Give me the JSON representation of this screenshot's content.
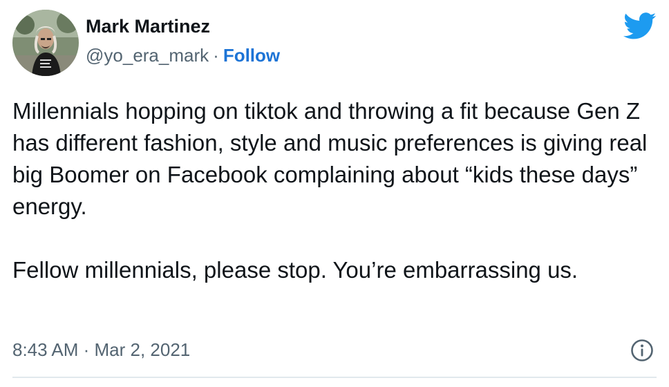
{
  "author": {
    "name": "Mark Martinez",
    "handle": "@yo_era_mark",
    "separator": "·",
    "follow_label": "Follow"
  },
  "tweet": {
    "paragraphs": [
      "Millennials hopping on tiktok and throwing a fit because Gen Z has different fashion, style and music preferences is giving real big Boomer on Facebook complaining about “kids these days” energy.",
      "Fellow millennials, please stop. You’re embarrassing us."
    ],
    "timestamp": "8:43 AM · Mar 2, 2021"
  },
  "icons": {
    "brand": "twitter-bird-icon",
    "info": "info-icon"
  },
  "colors": {
    "text": "#0f1419",
    "secondary": "#536471",
    "link": "#1d74d6",
    "brand": "#1d9bf0",
    "divider": "#e1e8ed"
  }
}
